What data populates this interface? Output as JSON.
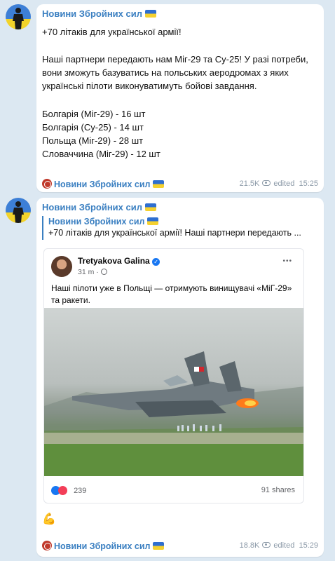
{
  "post1": {
    "channel": "Новини Збройних сил",
    "title": "+70 літаків для української армії!",
    "body": "Наші партнери передають нам Міг-29 та Су-25! У разі потреби, вони зможуть базуватись на польських аеродромах з яких українські пілоти виконуватимуть бойові завдання.",
    "list": [
      "Болгарія (Міг-29) - 16 шт",
      "Болгарія (Су-25) - 14 шт",
      "Польща (Міг-29) - 28 шт",
      "Словаччина (Міг-29) - 12 шт"
    ],
    "footer_channel": "Новини Збройних сил",
    "views": "21.5K",
    "edited": "edited",
    "time": "15:25"
  },
  "post2": {
    "channel": "Новини Збройних сил",
    "reply_channel": "Новини Збройних сил",
    "reply_text": "+70 літаків для української армії! Наші партнери передають ...",
    "fb": {
      "author": "Tretyakova Galina",
      "time": "31 m",
      "text": "Наші пілоти уже в Польщі — отримують винищувачі «МіГ-29» та ракети.",
      "reactions": "239",
      "shares": "91 shares",
      "more": "•••"
    },
    "emoji": "💪",
    "footer_channel": "Новини Збройних сил",
    "views": "18.8K",
    "edited": "edited",
    "time": "15:29"
  },
  "colors": {
    "accent": "#3a7fc1",
    "background": "#dce8f2"
  }
}
